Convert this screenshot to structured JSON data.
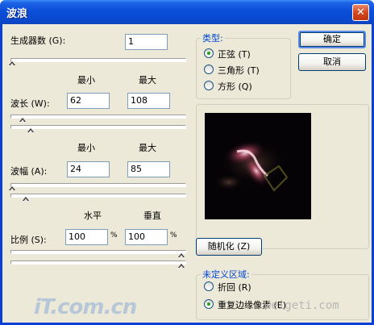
{
  "window": {
    "title": "波浪",
    "close_glyph": "✕"
  },
  "generators": {
    "label": "生成器数 (G):",
    "value": "1"
  },
  "range_headers": {
    "min": "最小",
    "max": "最大"
  },
  "wavelength": {
    "label": "波长 (W):",
    "min": "62",
    "max": "108"
  },
  "amplitude": {
    "label": "波幅 (A):",
    "min": "24",
    "max": "85"
  },
  "scale_headers": {
    "horizontal": "水平",
    "vertical": "垂直"
  },
  "scale": {
    "label": "比例 (S):",
    "horizontal": "100",
    "vertical": "100",
    "unit": "%"
  },
  "sliders": {
    "generators": 0.0,
    "wavelength_min": 0.06,
    "wavelength_max": 0.11,
    "amplitude_min": 0.0,
    "amplitude_max": 0.08,
    "scale_horizontal": 1.0,
    "scale_vertical": 1.0
  },
  "type_group": {
    "legend": "类型:",
    "options": [
      {
        "label": "正弦 (T)",
        "selected": true
      },
      {
        "label": "三角形 (T)",
        "selected": false
      },
      {
        "label": "方形 (Q)",
        "selected": false
      }
    ]
  },
  "buttons": {
    "ok": "确定",
    "cancel": "取消",
    "randomize": "随机化 (Z)"
  },
  "undefined_group": {
    "legend": "未定义区域:",
    "options": [
      {
        "label": "折回 (R)",
        "selected": false
      },
      {
        "label": "重复边缘像素 (E)",
        "selected": true
      }
    ]
  },
  "watermarks": {
    "left": "iT.com.cn",
    "right": "weigeti.com"
  },
  "colors": {
    "title_bar": "#0a48cf",
    "dialog_bg": "#ece9d8",
    "legend_text": "#0046d5",
    "radio_dot": "#21a121"
  }
}
